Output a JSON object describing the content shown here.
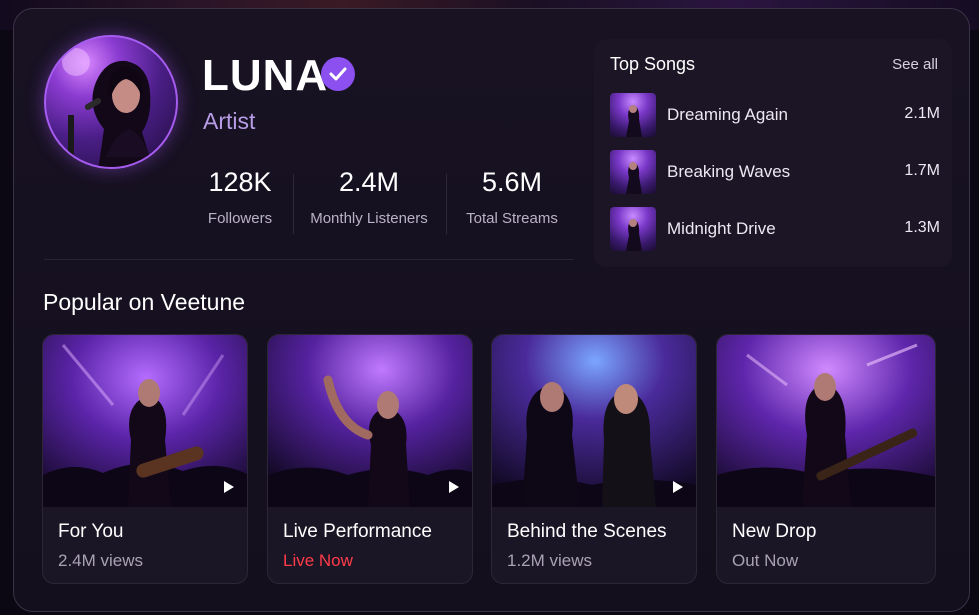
{
  "artist": {
    "name": "LUNA",
    "role": "Artist",
    "verified_icon": "verified-check-icon"
  },
  "stats": [
    {
      "value": "128K",
      "label": "Followers"
    },
    {
      "value": "2.4M",
      "label": "Monthly Listeners"
    },
    {
      "value": "5.6M",
      "label": "Total Streams"
    }
  ],
  "top_songs": {
    "title": "Top Songs",
    "see_all": "See all",
    "songs": [
      {
        "name": "Dreaming Again",
        "plays": "2.1M"
      },
      {
        "name": "Breaking Waves",
        "plays": "1.7M"
      },
      {
        "name": "Midnight Drive",
        "plays": "1.3M"
      }
    ]
  },
  "popular": {
    "title": "Popular on Veetune",
    "cards": [
      {
        "title": "For You",
        "subtitle": "2.4M views",
        "play_icon": "play-icon"
      },
      {
        "title": "Live Performance",
        "subtitle": "Live Now",
        "play_icon": "play-icon"
      },
      {
        "title": "Behind the Scenes",
        "subtitle": "1.2M views",
        "play_icon": "play-icon"
      },
      {
        "title": "New Drop",
        "subtitle": "Out Now"
      }
    ]
  },
  "colors": {
    "accent": "#8c4ff0",
    "live": "#ff3b4a",
    "background": "#0b0814",
    "card": "#181223"
  }
}
